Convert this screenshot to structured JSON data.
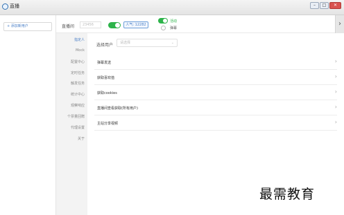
{
  "window": {
    "title": "直播",
    "controls": [
      "–",
      "□",
      "✕"
    ]
  },
  "left_panel": {
    "add_user_label": "+ 添加新用户"
  },
  "topbar": {
    "room_label": "直播间",
    "room_input_placeholder": "23456",
    "popularity": "人气: 12282",
    "status_active": "活动",
    "status_barrage": "弹幕",
    "collapse_glyph": "›"
  },
  "nav": {
    "items": [
      {
        "label": "指定人",
        "active": true
      },
      {
        "label": "Mock",
        "active": false
      },
      {
        "label": "配置中心",
        "active": false
      },
      {
        "label": "定时任务",
        "active": false
      },
      {
        "label": "触发任务",
        "active": false
      },
      {
        "label": "统计中心",
        "active": false
      },
      {
        "label": "观察响应",
        "active": false
      },
      {
        "label": "个票量回赠",
        "active": false
      },
      {
        "label": "代理设置",
        "active": false
      },
      {
        "label": "关于",
        "active": false
      }
    ]
  },
  "main": {
    "select_user_label": "选择用户",
    "select_placeholder": "请选择",
    "rows": [
      {
        "label": "弹幕发送"
      },
      {
        "label": "获取喜欢值"
      },
      {
        "label": "获取cookies"
      },
      {
        "label": "直播间查看获取(所有用户)"
      },
      {
        "label": "主站分享视频"
      }
    ]
  },
  "watermark": "最需教育",
  "colors": {
    "accent": "#4a7fc7",
    "toggle_on": "#2db34a",
    "nav_bg": "#f3f3f3"
  }
}
